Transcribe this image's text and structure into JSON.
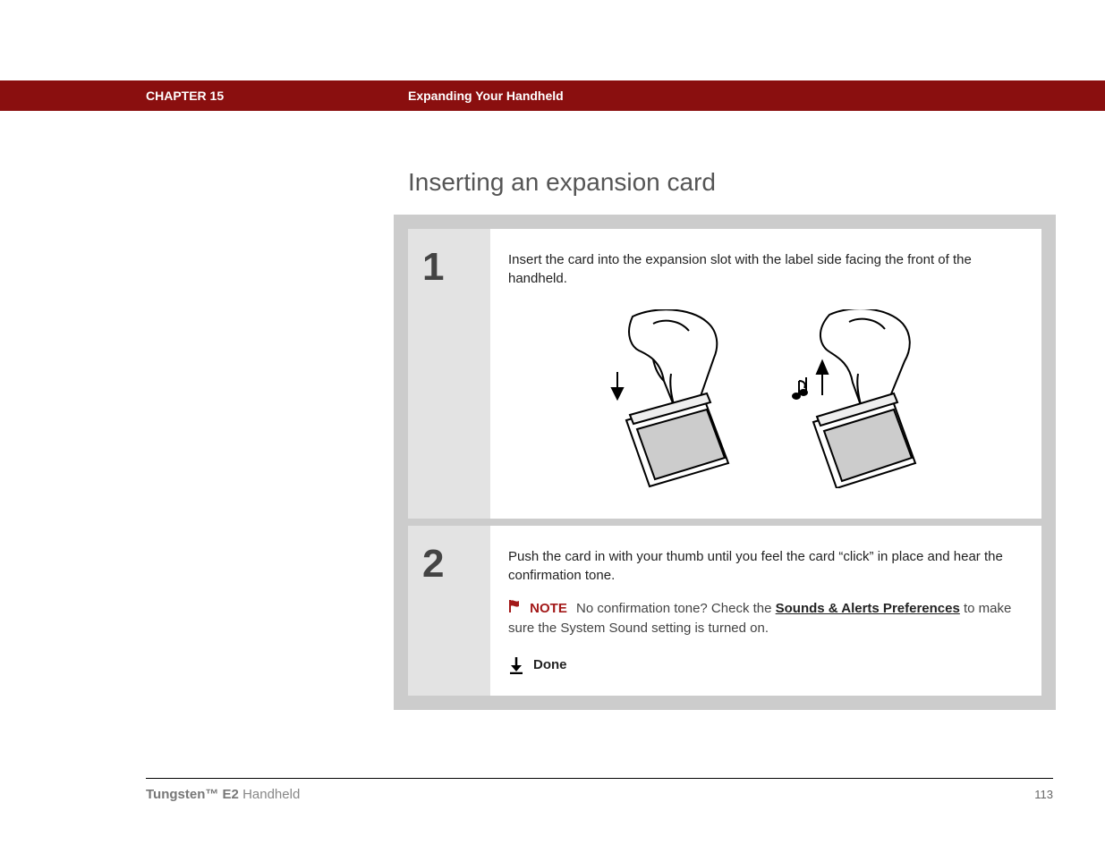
{
  "header": {
    "chapter": "CHAPTER 15",
    "title": "Expanding Your Handheld"
  },
  "section_title": "Inserting an expansion card",
  "steps": [
    {
      "number": "1",
      "text": "Insert the card into the expansion slot with the label side facing the front of the handheld."
    },
    {
      "number": "2",
      "text": "Push the card in with your thumb until you feel the card “click” in place and hear the confirmation tone.",
      "note_label": "NOTE",
      "note_before": "No confirmation tone? Check the ",
      "note_link": "Sounds & Alerts Preferences",
      "note_after": " to make sure the System Sound setting is turned on.",
      "done_label": "Done"
    }
  ],
  "footer": {
    "product_bold": "Tungsten™ E2",
    "product_rest": " Handheld",
    "page": "113"
  }
}
